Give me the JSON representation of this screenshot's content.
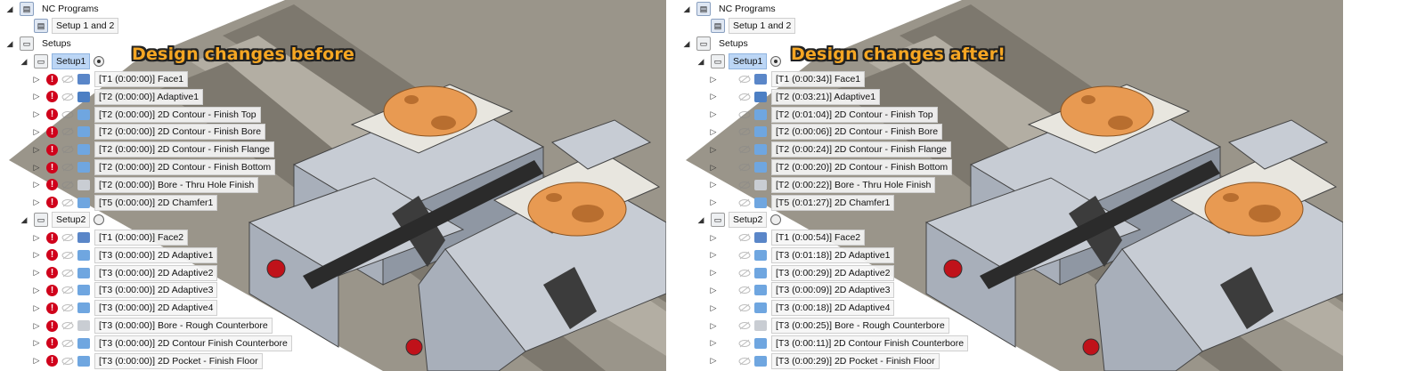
{
  "colors": {
    "accent": "#f5a623",
    "error": "#d0021b",
    "selection": "#bcd6f5",
    "part": "#e89a52"
  },
  "before": {
    "banner": "Design changes before",
    "tree": {
      "nc_programs": "NC Programs",
      "nc_setup": "Setup 1 and 2",
      "setups": "Setups",
      "setup1": "Setup1",
      "setup1_ops": [
        "[T1 (0:00:00)] Face1",
        "[T2 (0:00:00)] Adaptive1",
        "[T2 (0:00:00)] 2D Contour - Finish Top",
        "[T2 (0:00:00)] 2D Contour - Finish Bore",
        "[T2 (0:00:00)] 2D Contour - Finish Flange",
        "[T2 (0:00:00)] 2D Contour - Finish Bottom",
        "[T2 (0:00:00)] Bore - Thru Hole Finish",
        "[T5 (0:00:00)] 2D Chamfer1"
      ],
      "setup2": "Setup2",
      "setup2_ops": [
        "[T1 (0:00:00)] Face2",
        "[T3 (0:00:00)] 2D Adaptive1",
        "[T3 (0:00:00)] 2D Adaptive2",
        "[T3 (0:00:00)] 2D Adaptive3",
        "[T3 (0:00:00)] 2D Adaptive4",
        "[T3 (0:00:00)] Bore - Rough Counterbore",
        "[T3 (0:00:00)] 2D Contour Finish Counterbore",
        "[T3 (0:00:00)] 2D Pocket - Finish Floor"
      ]
    }
  },
  "after": {
    "banner": "Design changes after!",
    "tree": {
      "nc_programs": "NC Programs",
      "nc_setup": "Setup 1 and 2",
      "setups": "Setups",
      "setup1": "Setup1",
      "setup1_ops": [
        "[T1 (0:00:34)] Face1",
        "[T2 (0:03:21)] Adaptive1",
        "[T2 (0:01:04)] 2D Contour - Finish Top",
        "[T2 (0:00:06)] 2D Contour - Finish Bore",
        "[T2 (0:00:24)] 2D Contour - Finish Flange",
        "[T2 (0:00:20)] 2D Contour - Finish Bottom",
        "[T2 (0:00:22)] Bore - Thru Hole Finish",
        "[T5 (0:01:27)] 2D Chamfer1"
      ],
      "setup2": "Setup2",
      "setup2_ops": [
        "[T1 (0:00:54)] Face2",
        "[T3 (0:01:18)] 2D Adaptive1",
        "[T3 (0:00:29)] 2D Adaptive2",
        "[T3 (0:00:09)] 2D Adaptive3",
        "[T3 (0:00:18)] 2D Adaptive4",
        "[T3 (0:00:25)] Bore - Rough Counterbore",
        "[T3 (0:00:11)] 2D Contour Finish Counterbore",
        "[T3 (0:00:29)] 2D Pocket - Finish Floor"
      ]
    }
  }
}
